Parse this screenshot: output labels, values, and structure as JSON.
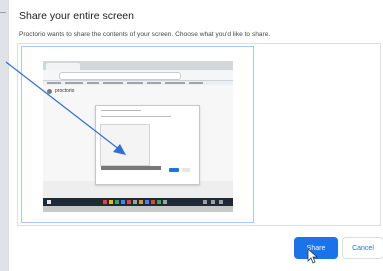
{
  "dialog": {
    "title": "Share your entire screen",
    "description": "Proctorio wants to share the contents of your screen. Choose what you'd like to share."
  },
  "thumbnail": {
    "page_name": "proctorio"
  },
  "buttons": {
    "share_label": "Share",
    "cancel_label": "Cancel"
  },
  "colors": {
    "accent": "#1a73e8",
    "selection_border": "#a8c7fa",
    "annotation_arrow": "#2e6fd8"
  }
}
